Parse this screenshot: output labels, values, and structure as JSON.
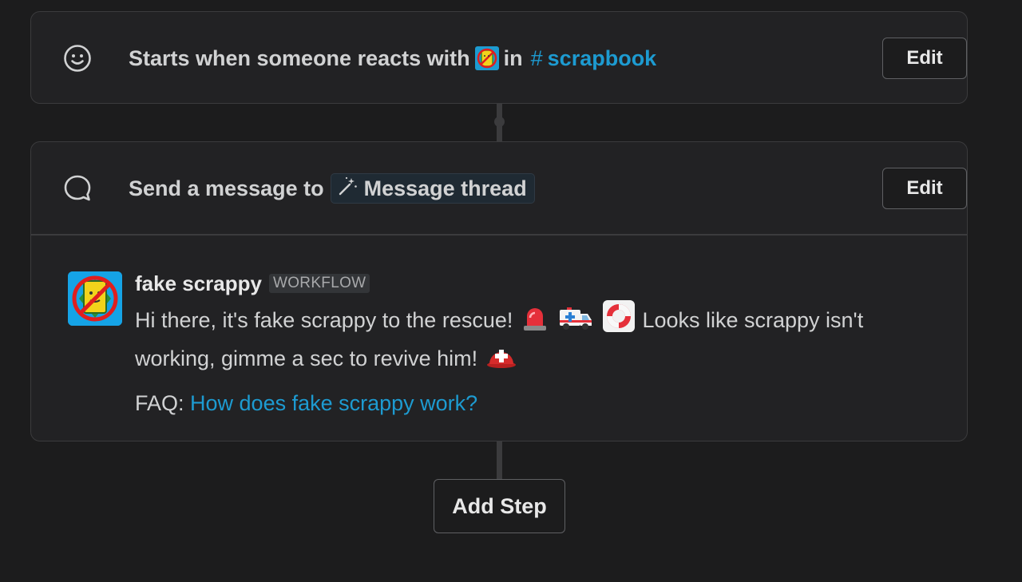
{
  "trigger": {
    "icon": "smile-icon",
    "text_before": "Starts when someone reacts with",
    "emoji": "scrappy-emoji",
    "text_in": "in",
    "channel_hash": "#",
    "channel_name": "scrapbook",
    "edit_label": "Edit"
  },
  "step": {
    "icon": "message-bubble-icon",
    "text": "Send a message to",
    "variable_icon": "magic-wand-icon",
    "variable_label": "Message thread",
    "edit_label": "Edit"
  },
  "message": {
    "sender": "fake scrappy",
    "badge": "WORKFLOW",
    "line1_part1": "Hi there, it's fake scrappy to the rescue!",
    "line1_part2": "Looks like scrappy isn't",
    "line2": "working, gimme a sec to revive him!",
    "faq_prefix": "FAQ:",
    "faq_link": "How does fake scrappy work?"
  },
  "add_step_label": "Add Step",
  "colors": {
    "background": "#1c1c1d",
    "card": "#222224",
    "link": "#1d9bd1",
    "border": "#3b3b3d"
  }
}
